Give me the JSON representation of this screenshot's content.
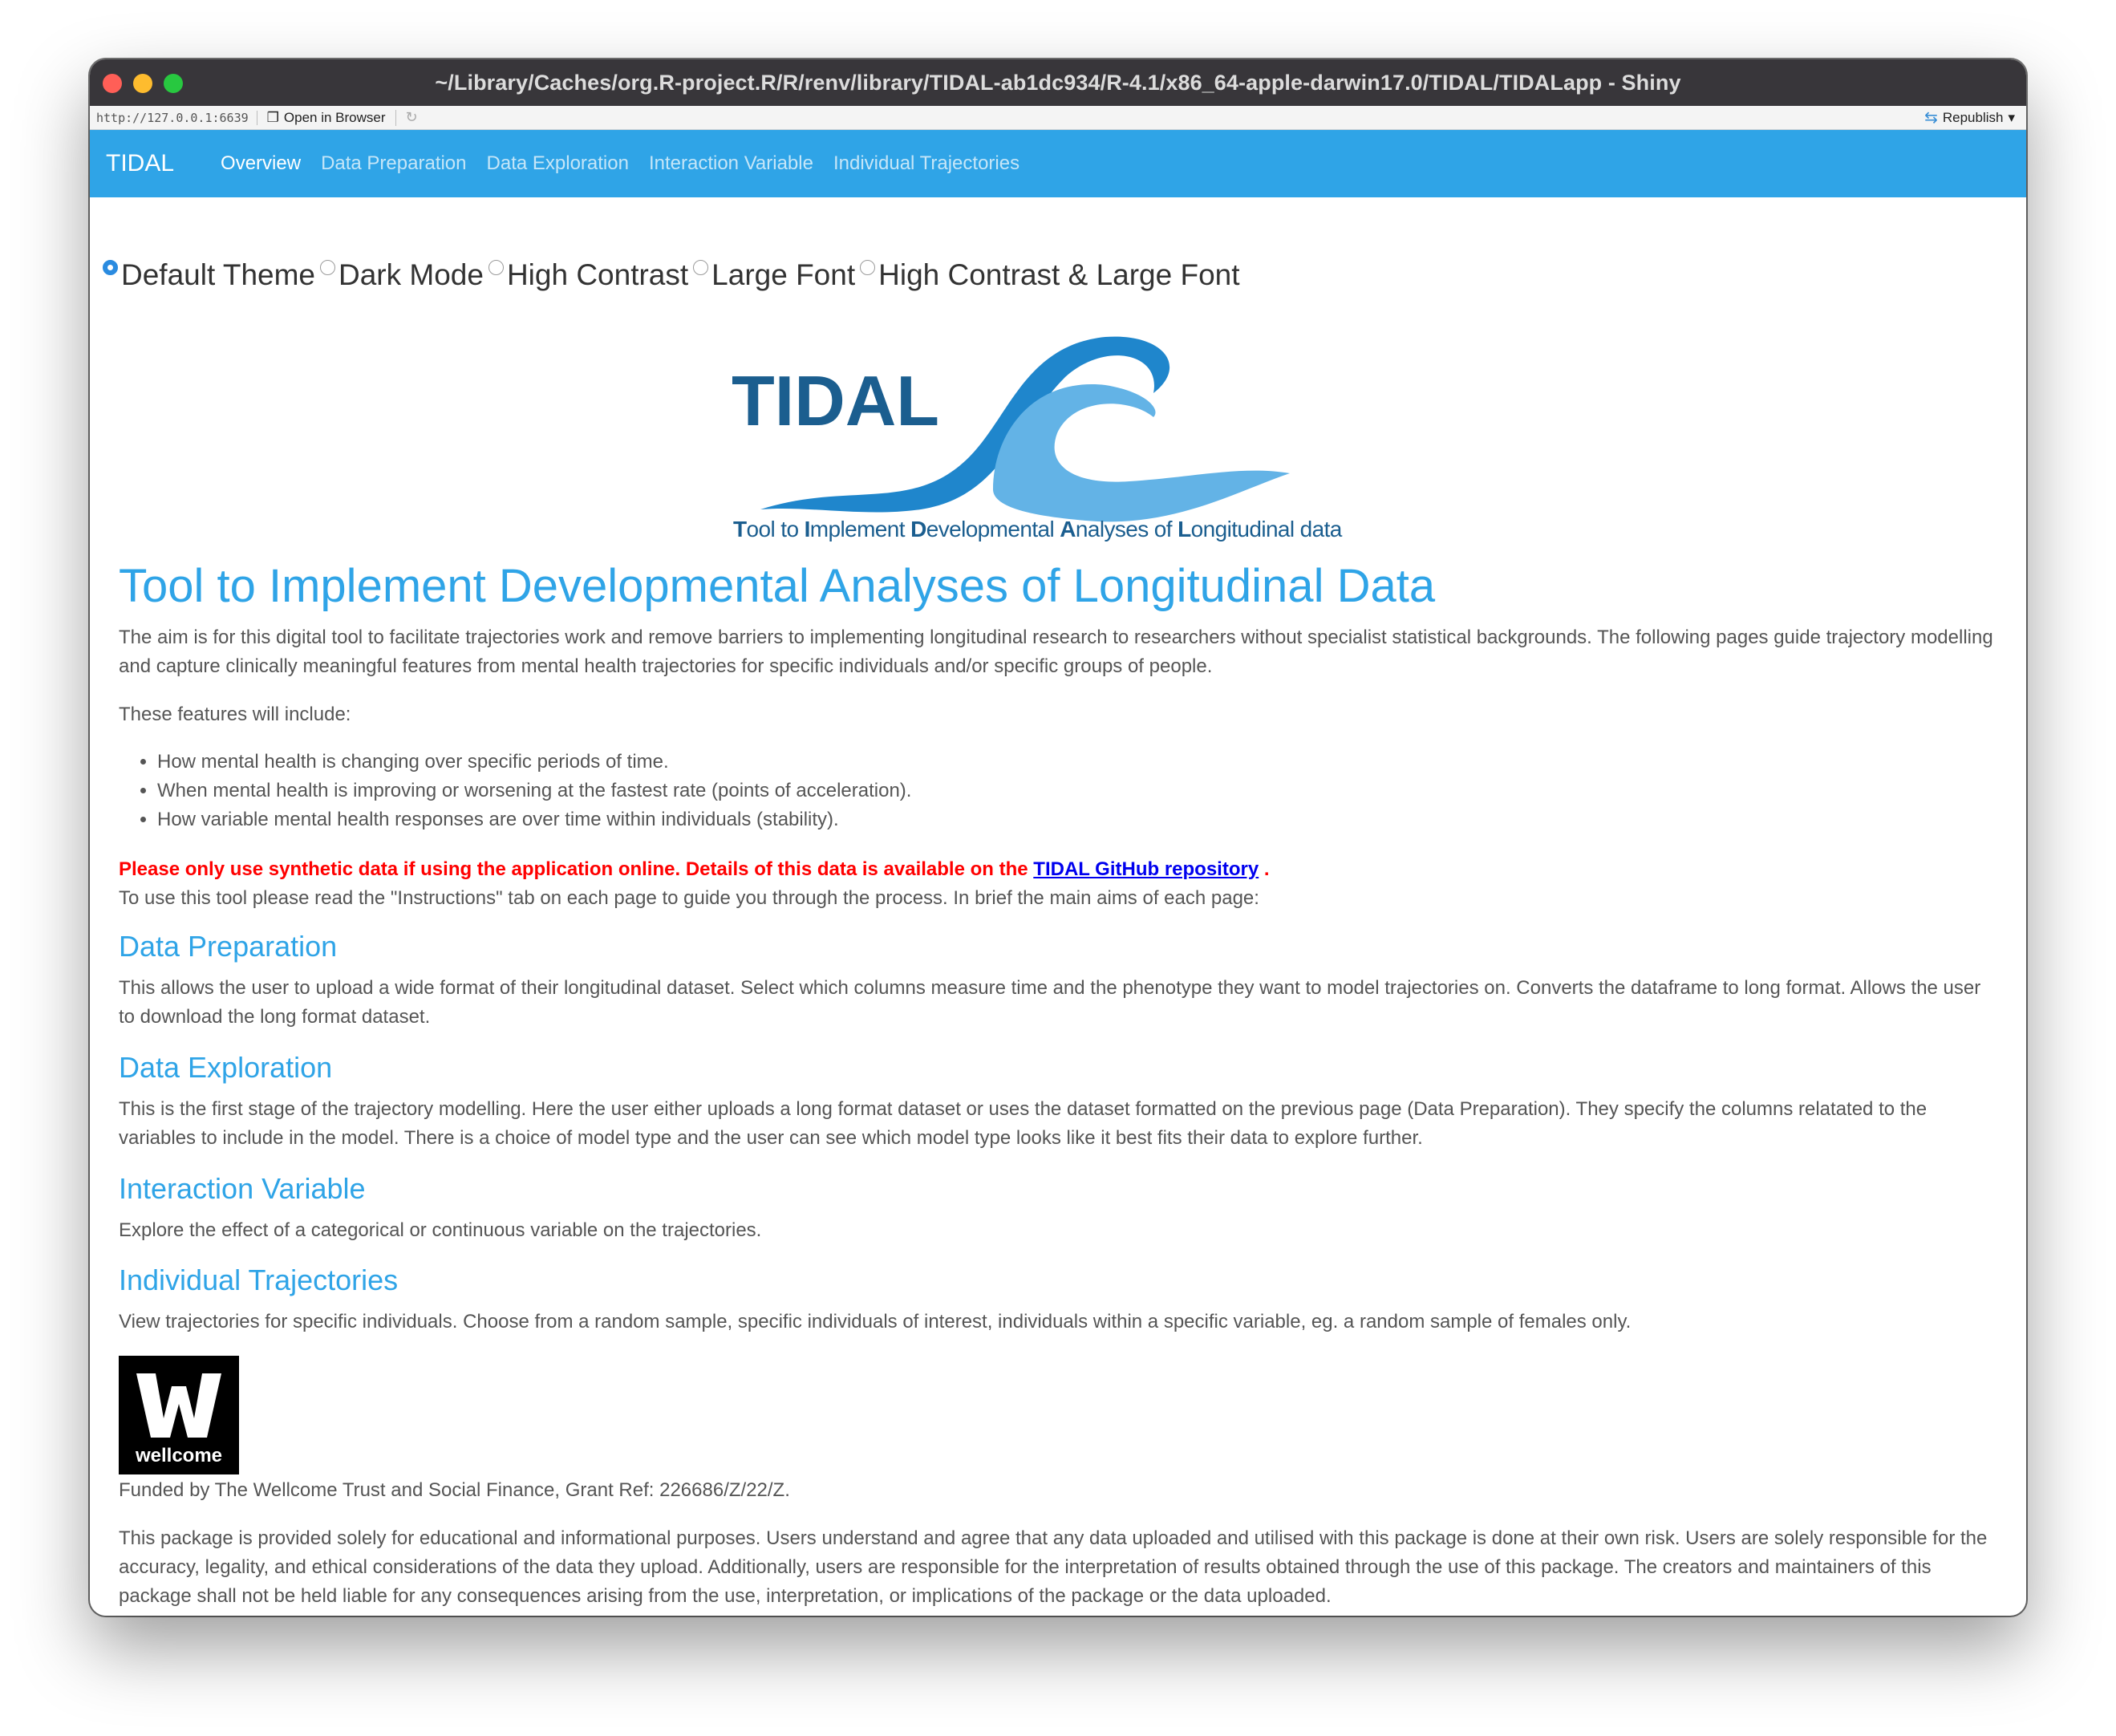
{
  "window": {
    "title": "~/Library/Caches/org.R-project.R/R/renv/library/TIDAL-ab1dc934/R-4.1/x86_64-apple-darwin17.0/TIDAL/TIDALapp - Shiny"
  },
  "toolbar": {
    "url": "http://127.0.0.1:6639",
    "open_in_browser": "Open in Browser",
    "republish": "Republish"
  },
  "navbar": {
    "brand": "TIDAL",
    "tabs": [
      "Overview",
      "Data Preparation",
      "Data Exploration",
      "Interaction Variable",
      "Individual Trajectories"
    ],
    "active_tab": "Overview"
  },
  "themes": {
    "options": [
      "Default Theme",
      "Dark Mode",
      "High Contrast",
      "Large Font",
      "High Contrast & Large Font"
    ],
    "selected": "Default Theme"
  },
  "logo": {
    "wordmark": "TIDAL",
    "tagline_parts": [
      {
        "initial": "T",
        "rest": "ool to "
      },
      {
        "initial": "I",
        "rest": "mplement "
      },
      {
        "initial": "D",
        "rest": "evelopmental "
      },
      {
        "initial": "A",
        "rest": "nalyses of "
      },
      {
        "initial": "L",
        "rest": "ongitudinal data"
      }
    ]
  },
  "main": {
    "heading": "Tool to Implement Developmental Analyses of Longitudinal Data",
    "intro": "The aim is for this digital tool to facilitate trajectories work and remove barriers to implementing longitudinal research to researchers without specialist statistical backgrounds. The following pages guide trajectory modelling and capture clinically meaningful features from mental health trajectories for specific individuals and/or specific groups of people.",
    "features_intro": "These features will include:",
    "features": [
      "How mental health is changing over specific periods of time.",
      "When mental health is improving or worsening at the fastest rate (points of acceleration).",
      "How variable mental health responses are over time within individuals (stability)."
    ],
    "warning_text": "Please only use synthetic data if using the application online. Details of this data is available on the",
    "warning_link": "TIDAL GitHub repository",
    "warning_end": ".",
    "instructions": "To use this tool please read the \"Instructions\" tab on each page to guide you through the process. In brief the main aims of each page:",
    "sections": [
      {
        "title": "Data Preparation",
        "body": "This allows the user to upload a wide format of their longitudinal dataset. Select which columns measure time and the phenotype they want to model trajectories on. Converts the dataframe to long format. Allows the user to download the long format dataset."
      },
      {
        "title": "Data Exploration",
        "body": "This is the first stage of the trajectory modelling. Here the user either uploads a long format dataset or uses the dataset formatted on the previous page (Data Preparation). They specify the columns relatated to the variables to include in the model. There is a choice of model type and the user can see which model type looks like it best fits their data to explore further."
      },
      {
        "title": "Interaction Variable",
        "body": "Explore the effect of a categorical or continuous variable on the trajectories."
      },
      {
        "title": "Individual Trajectories",
        "body": "View trajectories for specific individuals. Choose from a random sample, specific individuals of interest, individuals within a specific variable, eg. a random sample of females only."
      }
    ],
    "funder_logo_text": "wellcome",
    "funding": "Funded by The Wellcome Trust and Social Finance, Grant Ref: 226686/Z/22/Z.",
    "disclaimer": "This package is provided solely for educational and informational purposes. Users understand and agree that any data uploaded and utilised with this package is done at their own risk. Users are solely responsible for the accuracy, legality, and ethical considerations of the data they upload. Additionally, users are responsible for the interpretation of results obtained through the use of this package. The creators and maintainers of this package shall not be held liable for any consequences arising from the use, interpretation, or implications of the package or the data uploaded."
  },
  "colors": {
    "accent": "#2fa4e7",
    "warning": "#ff0000",
    "link": "#0000ee",
    "logo_dark": "#1b5e8f",
    "logo_mid": "#1f86cc",
    "logo_light": "#63b3e6"
  }
}
